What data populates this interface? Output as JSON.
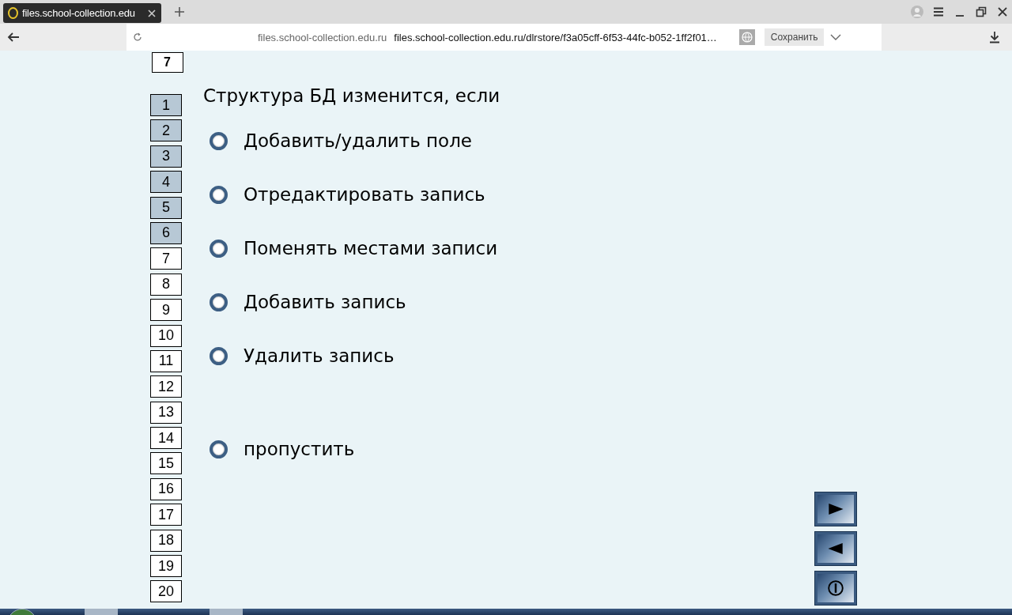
{
  "browser": {
    "tab_title": "files.school-collection.edu",
    "domain": "files.school-collection.edu.ru",
    "url": "files.school-collection.edu.ru/dlrstore/f3a05cff-6f53-44fc-b052-1ff2f01…",
    "save_button": "Сохранить"
  },
  "current_question": "7",
  "question_list": [
    {
      "label": "1",
      "answered": true
    },
    {
      "label": "2",
      "answered": true
    },
    {
      "label": "3",
      "answered": true
    },
    {
      "label": "4",
      "answered": true
    },
    {
      "label": "5",
      "answered": true
    },
    {
      "label": "6",
      "answered": true
    },
    {
      "label": "7",
      "answered": false
    },
    {
      "label": "8",
      "answered": false
    },
    {
      "label": "9",
      "answered": false
    },
    {
      "label": "10",
      "answered": false
    },
    {
      "label": "11",
      "answered": false
    },
    {
      "label": "12",
      "answered": false
    },
    {
      "label": "13",
      "answered": false
    },
    {
      "label": "14",
      "answered": false
    },
    {
      "label": "15",
      "answered": false
    },
    {
      "label": "16",
      "answered": false
    },
    {
      "label": "17",
      "answered": false
    },
    {
      "label": "18",
      "answered": false
    },
    {
      "label": "19",
      "answered": false
    },
    {
      "label": "20",
      "answered": false
    }
  ],
  "question": "Структура БД изменится, если",
  "options": [
    {
      "label": "Добавить/удалить поле",
      "selected": false
    },
    {
      "label": "Отредактировать запись",
      "selected": false
    },
    {
      "label": "Поменять местами записи",
      "selected": false
    },
    {
      "label": "Добавить запись",
      "selected": false
    },
    {
      "label": "Удалить запись",
      "selected": false
    }
  ],
  "skip_option": {
    "label": "пропустить",
    "selected": false
  }
}
